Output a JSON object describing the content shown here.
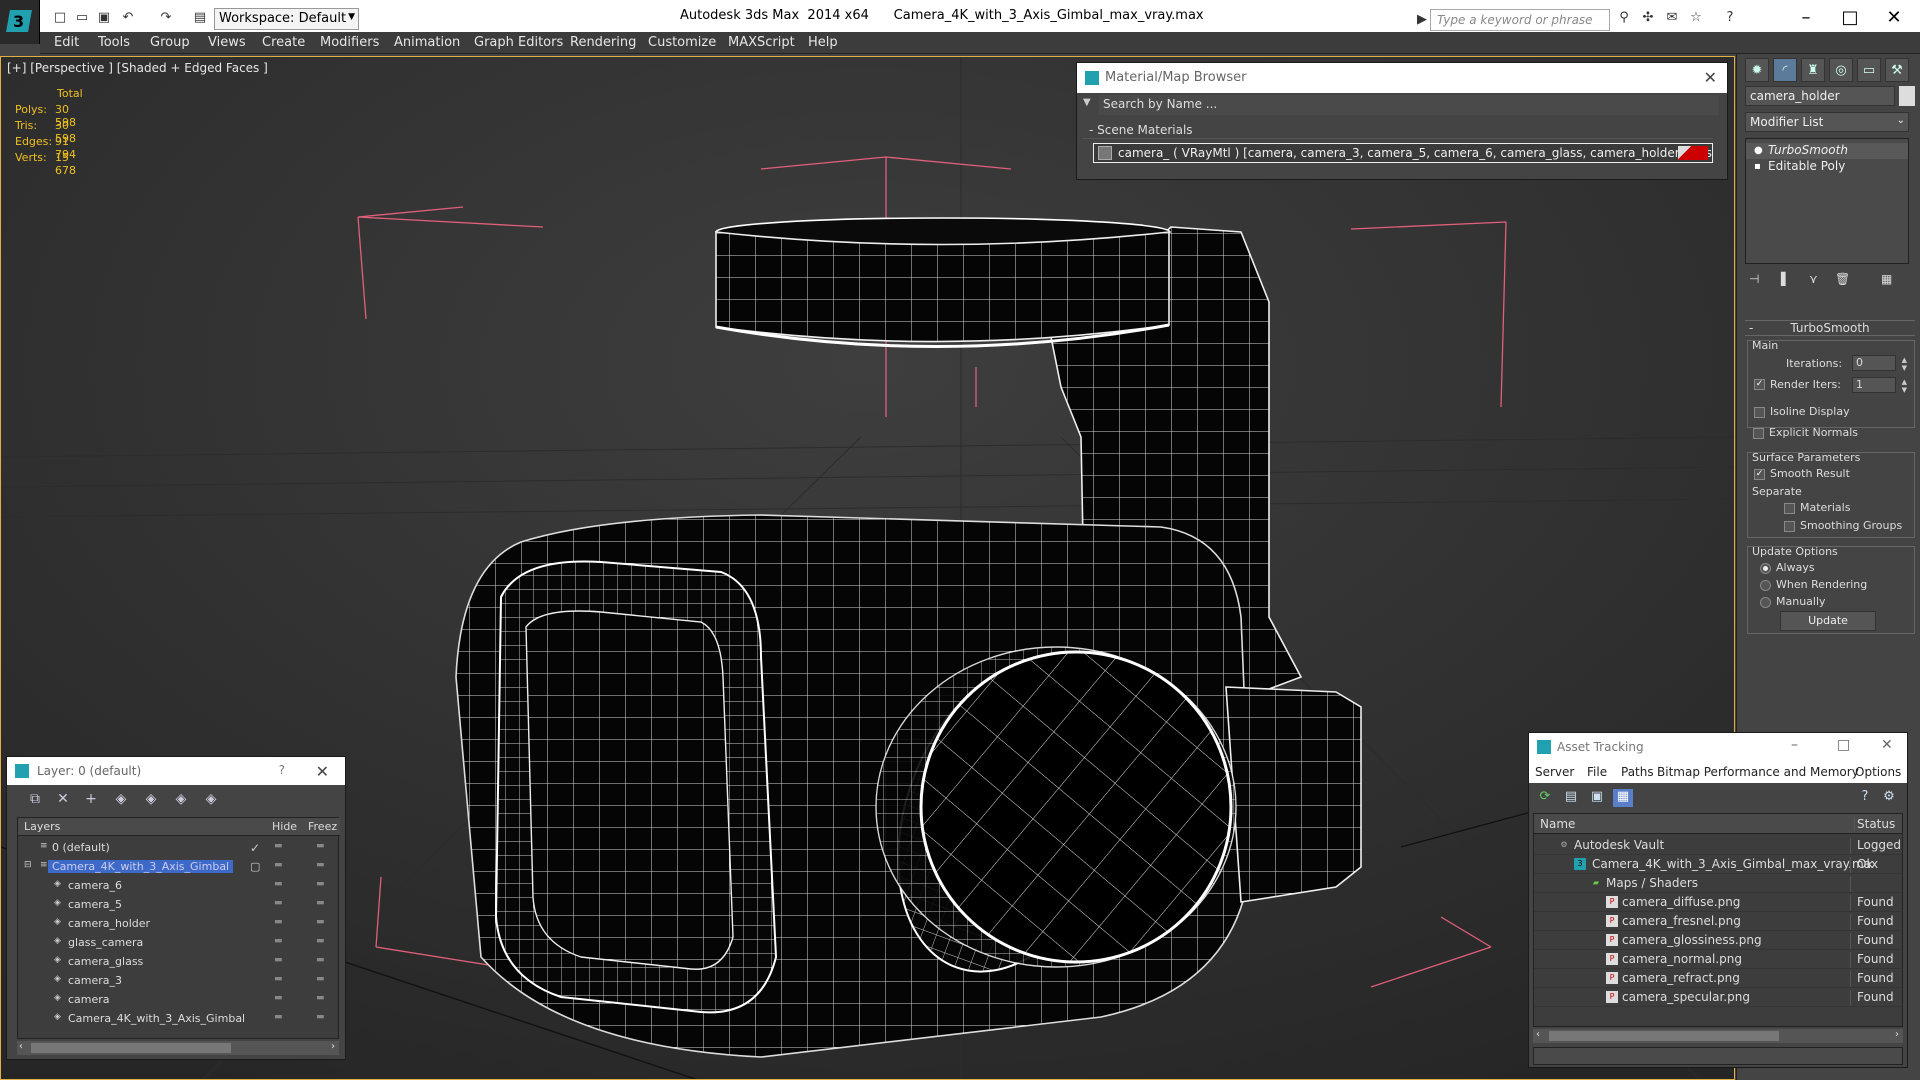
{
  "titlebar": {
    "workspace": "Workspace: Default",
    "title": "Autodesk 3ds Max  2014 x64      Camera_4K_with_3_Axis_Gimbal_max_vray.max",
    "search_placeholder": "Type a keyword or phrase"
  },
  "menu": [
    "Edit",
    "Tools",
    "Group",
    "Views",
    "Create",
    "Modifiers",
    "Animation",
    "Graph Editors",
    "Rendering",
    "Customize",
    "MAXScript",
    "Help"
  ],
  "viewport": {
    "label": "[+] [Perspective ] [Shaded + Edged Faces ]",
    "stats": {
      "header": "Total",
      "rows": [
        {
          "label": "Polys:",
          "value": "30 598"
        },
        {
          "label": "Tris:",
          "value": "30 598"
        },
        {
          "label": "Edges:",
          "value": "91 794"
        },
        {
          "label": "Verts:",
          "value": "15 678"
        }
      ]
    }
  },
  "material_browser": {
    "title": "Material/Map Browser",
    "search_placeholder": "Search by Name ...",
    "section": "Scene Materials",
    "material": "camera_  ( VRayMtl ) [camera, camera_3, camera_5, camera_6, camera_glass, camera_holder, glass_camera]"
  },
  "command_panel": {
    "object_name": "camera_holder",
    "modifier_list": "Modifier List",
    "stack": [
      "TurboSmooth",
      "Editable Poly"
    ],
    "rollout": "TurboSmooth",
    "main_label": "Main",
    "iterations_label": "Iterations:",
    "iterations_value": "0",
    "render_iters_label": "Render Iters:",
    "render_iters_value": "1",
    "isoline": "Isoline Display",
    "explicit": "Explicit Normals",
    "surface_params": "Surface Parameters",
    "smooth_result": "Smooth Result",
    "separate": "Separate",
    "materials": "Materials",
    "smoothing_groups": "Smoothing Groups",
    "update_options": "Update Options",
    "always": "Always",
    "when_rendering": "When Rendering",
    "manually": "Manually",
    "update_button": "Update"
  },
  "layer_explorer": {
    "title": "Layer: 0 (default)",
    "help": "?",
    "col_layers": "Layers",
    "col_hide": "Hide",
    "col_freeze": "Freez",
    "rows": [
      {
        "name": "0 (default)",
        "indent": 0
      },
      {
        "name": "Camera_4K_with_3_Axis_Gimbal",
        "indent": 0
      },
      {
        "name": "camera_6",
        "indent": 1
      },
      {
        "name": "camera_5",
        "indent": 1
      },
      {
        "name": "camera_holder",
        "indent": 1
      },
      {
        "name": "glass_camera",
        "indent": 1
      },
      {
        "name": "camera_glass",
        "indent": 1
      },
      {
        "name": "camera_3",
        "indent": 1
      },
      {
        "name": "camera",
        "indent": 1
      },
      {
        "name": "Camera_4K_with_3_Axis_Gimbal",
        "indent": 1
      }
    ]
  },
  "asset_tracking": {
    "title": "Asset Tracking",
    "menu": [
      "Server",
      "File",
      "Paths",
      "Bitmap Performance and Memory",
      "Options"
    ],
    "col_name": "Name",
    "col_status": "Status",
    "rows": [
      {
        "name": "Autodesk Vault",
        "status": "Logged O",
        "indent": 1,
        "icon": "vault"
      },
      {
        "name": "Camera_4K_with_3_Axis_Gimbal_max_vray.max",
        "status": "Ok",
        "indent": 2,
        "icon": "max"
      },
      {
        "name": "Maps / Shaders",
        "status": "",
        "indent": 3,
        "icon": "maps"
      },
      {
        "name": "camera_diffuse.png",
        "status": "Found",
        "indent": 4,
        "icon": "png"
      },
      {
        "name": "camera_fresnel.png",
        "status": "Found",
        "indent": 4,
        "icon": "png"
      },
      {
        "name": "camera_glossiness.png",
        "status": "Found",
        "indent": 4,
        "icon": "png"
      },
      {
        "name": "camera_normal.png",
        "status": "Found",
        "indent": 4,
        "icon": "png"
      },
      {
        "name": "camera_refract.png",
        "status": "Found",
        "indent": 4,
        "icon": "png"
      },
      {
        "name": "camera_specular.png",
        "status": "Found",
        "indent": 4,
        "icon": "png"
      }
    ]
  },
  "colors": {
    "selection": "#3d6ac8",
    "stats": "#f0c020",
    "bbox": "#e0607a"
  }
}
